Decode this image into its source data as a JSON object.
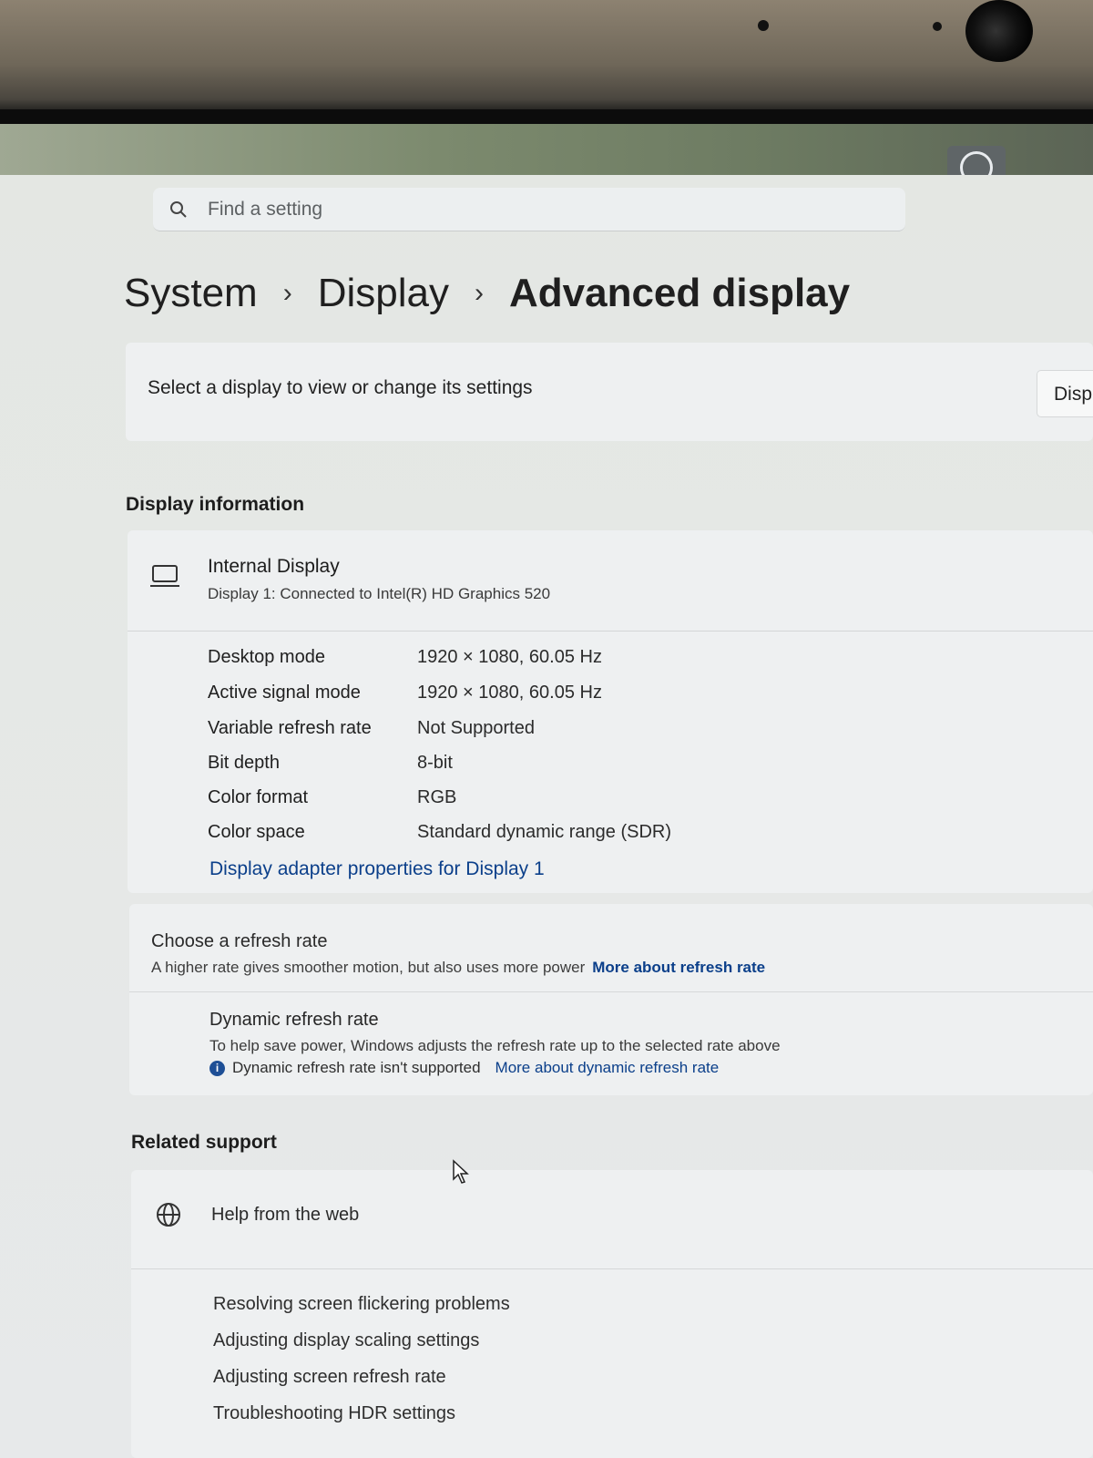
{
  "search": {
    "placeholder": "Find a setting"
  },
  "breadcrumb": {
    "items": [
      "System",
      "Display",
      "Advanced display"
    ]
  },
  "display_select": {
    "prompt": "Select a display to view or change its settings",
    "dropdown_value": "Disp"
  },
  "display_information": {
    "heading": "Display information",
    "name": "Internal Display",
    "subtitle": "Display 1: Connected to Intel(R) HD Graphics 520",
    "properties": [
      {
        "key": "Desktop mode",
        "value": "1920 × 1080, 60.05 Hz"
      },
      {
        "key": "Active signal mode",
        "value": "1920 × 1080, 60.05 Hz"
      },
      {
        "key": "Variable refresh rate",
        "value": "Not Supported"
      },
      {
        "key": "Bit depth",
        "value": "8-bit"
      },
      {
        "key": "Color format",
        "value": "RGB"
      },
      {
        "key": "Color space",
        "value": "Standard dynamic range (SDR)"
      }
    ],
    "adapter_link": "Display adapter properties for Display 1"
  },
  "refresh_rate": {
    "title": "Choose a refresh rate",
    "subtitle": "A higher rate gives smoother motion, but also uses more power",
    "link": "More about refresh rate",
    "dynamic": {
      "title": "Dynamic refresh rate",
      "subtitle": "To help save power, Windows adjusts the refresh rate up to the selected rate above",
      "note": "Dynamic refresh rate isn't supported",
      "link": "More about dynamic refresh rate"
    }
  },
  "related_support": {
    "heading": "Related support",
    "help_label": "Help from the web",
    "links": [
      "Resolving screen flickering problems",
      "Adjusting display scaling settings",
      "Adjusting screen refresh rate",
      "Troubleshooting HDR settings"
    ]
  },
  "icons": [
    "search-icon",
    "laptop-icon",
    "info-icon",
    "globe-icon",
    "user-icon",
    "mouse-cursor-icon"
  ],
  "colors": {
    "link": "#0b3f8a",
    "info_badge": "#1e4f96"
  }
}
